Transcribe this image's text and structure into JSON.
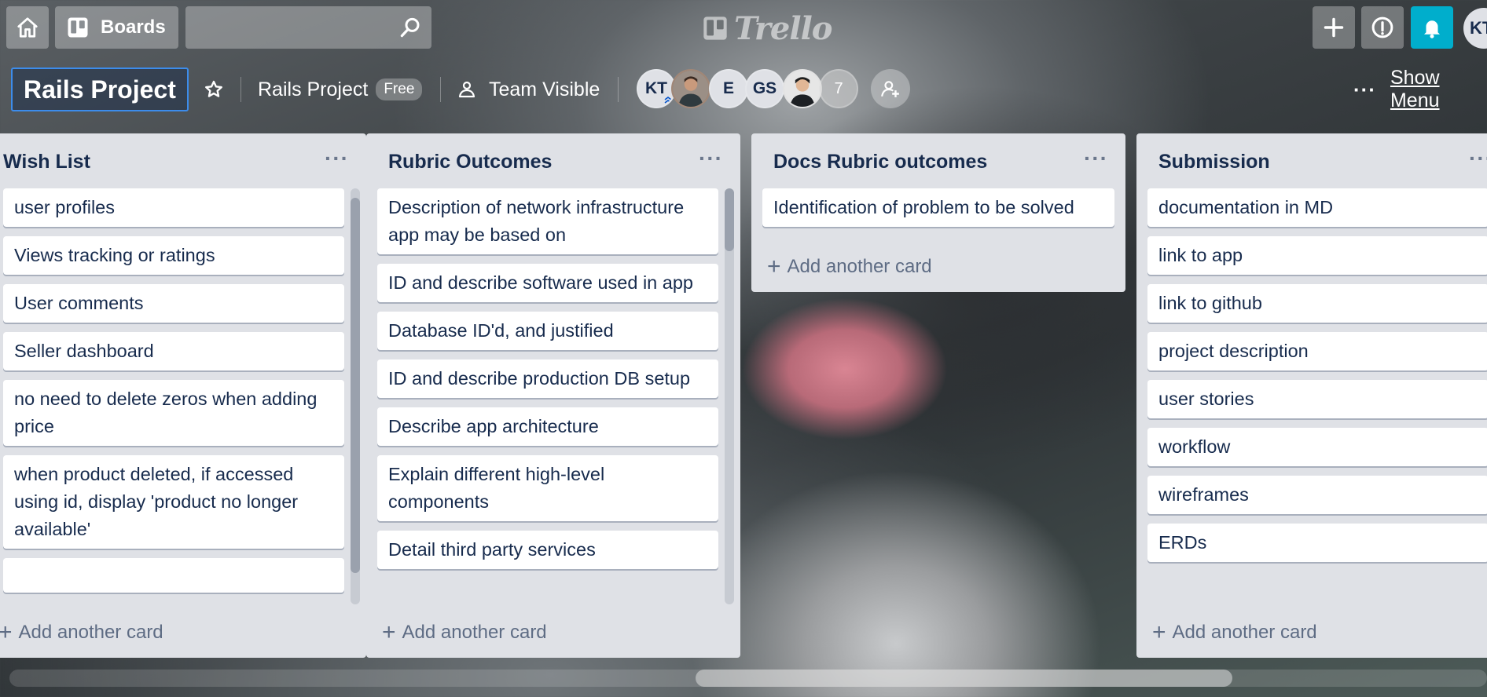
{
  "header": {
    "boards_label": "Boards",
    "search_value": "",
    "logo_text": "Trello",
    "account_initials": "KT"
  },
  "board": {
    "title": "Rails Project",
    "team_name": "Rails Project",
    "plan_badge": "Free",
    "visibility": "Team Visible",
    "members": [
      "KT",
      "photo",
      "E",
      "GS",
      "photo"
    ],
    "more_members": "7",
    "show_menu": "Show Menu"
  },
  "lists": [
    {
      "title": "Wish List",
      "cards": [
        "user profiles",
        "Views tracking or ratings",
        "User comments",
        "Seller dashboard",
        "no need to delete zeros when adding price",
        "when product deleted, if accessed using id, display 'product no longer available'",
        ""
      ],
      "add_label": "Add another card"
    },
    {
      "title": "Rubric Outcomes",
      "cards": [
        "Description of network infrastructure app may be based on",
        "ID and describe software used in app",
        "Database ID'd, and justified",
        "ID and describe production DB setup",
        "Describe app architecture",
        "Explain different high-level components",
        "Detail third party services"
      ],
      "add_label": "Add another card"
    },
    {
      "title": "Docs Rubric outcomes",
      "cards": [
        "Identification of problem to be solved"
      ],
      "add_label": "Add another card"
    },
    {
      "title": "Submission",
      "cards": [
        "documentation in MD",
        "link to app",
        "link to github",
        "project description",
        "user stories",
        "workflow",
        "wireframes",
        "ERDs"
      ],
      "add_label": "Add another card"
    }
  ],
  "colors": {
    "notification_accent": "#00aecc",
    "list_background": "#dfe1e6",
    "title_focus_border": "#3c8ceb"
  }
}
